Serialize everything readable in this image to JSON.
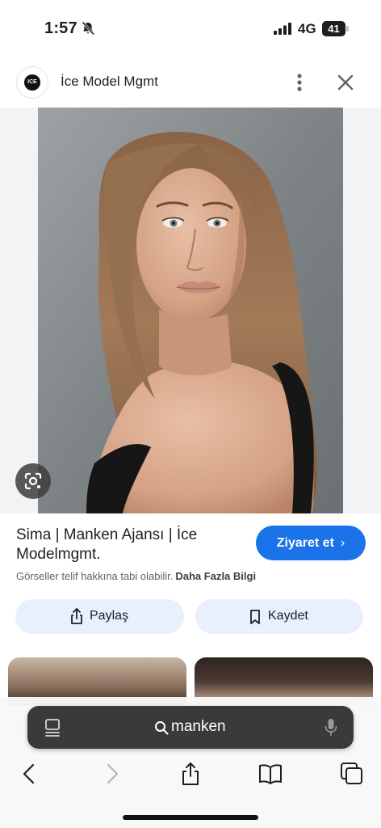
{
  "status_bar": {
    "time": "1:57",
    "network": "4G",
    "battery": "41"
  },
  "header": {
    "logo_text": "ICE",
    "site_name": "İce Model Mgmt"
  },
  "result": {
    "title": "Sima | Manken Ajansı | İce Modelmgmt.",
    "visit_label": "Ziyaret et",
    "copyright_text": "Görseller telif hakkına tabi olabilir.",
    "more_info_label": "Daha Fazla Bilgi",
    "share_label": "Paylaş",
    "save_label": "Kaydet"
  },
  "browser": {
    "search_query": "manken"
  },
  "colors": {
    "accent": "#1a73e8",
    "pill_bg": "#e8effd",
    "search_bar_bg": "#3a3a3c"
  }
}
